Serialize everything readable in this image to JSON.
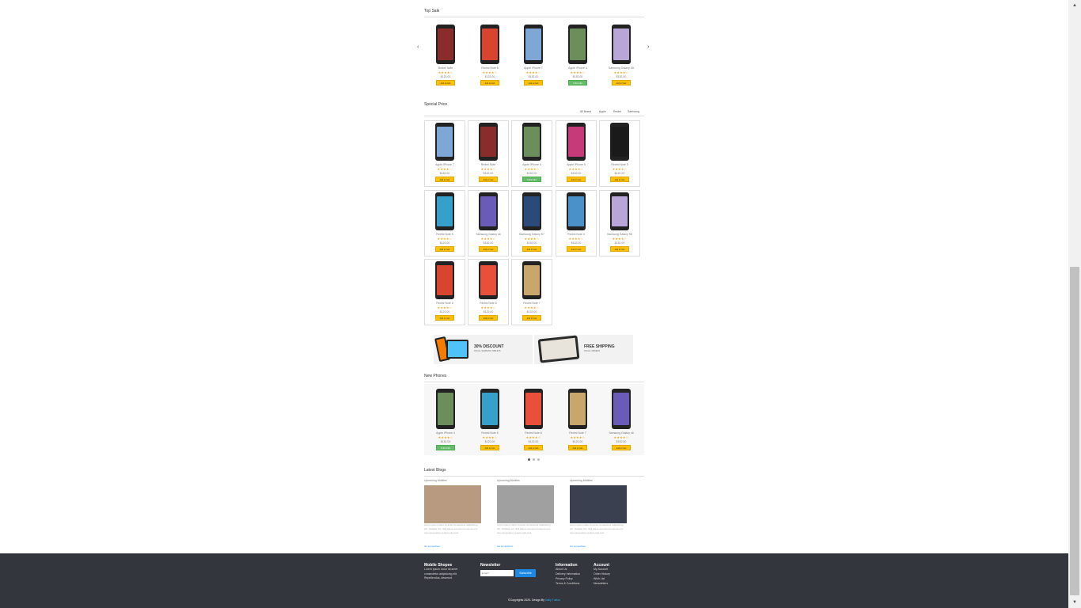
{
  "top_sale": {
    "title": "Top Sale",
    "prev_icon": "‹",
    "next_icon": "›",
    "items": [
      {
        "name": "Redmi Note",
        "stars": "★★★★☆",
        "price": "$120.00",
        "button": "Add to Cart",
        "button_style": "yellow",
        "screen": "#8b2c2c"
      },
      {
        "name": "Redmi Note 6",
        "stars": "★★★★☆",
        "price": "$122.00",
        "button": "Add to Cart",
        "button_style": "yellow",
        "screen": "#d9442f"
      },
      {
        "name": "Apple iPhone 7",
        "stars": "★★★★☆",
        "price": "$152.00",
        "button": "Add to Cart",
        "button_style": "yellow",
        "screen": "#7fa7d6"
      },
      {
        "name": "Apple iPhone 4",
        "stars": "★★★★☆",
        "price": "$152.00",
        "button": "In the Cart",
        "button_style": "green",
        "screen": "#6b8e5a"
      },
      {
        "name": "Samsung Galaxy S6",
        "stars": "★★★★☆",
        "price": "$152.00",
        "button": "Add to Cart",
        "button_style": "yellow",
        "screen": "#b8a6d9"
      }
    ]
  },
  "special_price": {
    "title": "Special Price",
    "filters": [
      "All Brand",
      "Apple",
      "Redmi",
      "Samsung"
    ],
    "items": [
      {
        "name": "Apple iPhone 7",
        "stars": "★★★★☆",
        "price": "$152.00",
        "button": "Add to Cart",
        "button_style": "yellow",
        "screen": "#7fa7d6"
      },
      {
        "name": "Redmi Note",
        "stars": "★★★★☆",
        "price": "$122.00",
        "button": "Add to Cart",
        "button_style": "yellow",
        "screen": "#8b2c2c"
      },
      {
        "name": "Apple iPhone 4",
        "stars": "★★★★☆",
        "price": "$152.00",
        "button": "In the Cart",
        "button_style": "green",
        "screen": "#6b8e5a"
      },
      {
        "name": "Apple iPhone 5",
        "stars": "★★★★☆",
        "price": "$152.00",
        "button": "Add to Cart",
        "button_style": "yellow",
        "screen": "#c63a7a"
      },
      {
        "name": "Redmi Note 5",
        "stars": "★★★★☆",
        "price": "$122.00",
        "button": "Add to Cart",
        "button_style": "yellow",
        "screen": "#1a1a1a"
      },
      {
        "name": "Redmi Note 5",
        "stars": "★★★★☆",
        "price": "$122.00",
        "button": "Add to Cart",
        "button_style": "yellow",
        "screen": "#35a0c9"
      },
      {
        "name": "Samsung Galaxy s6",
        "stars": "★★★★☆",
        "price": "$152.00",
        "button": "Add to Cart",
        "button_style": "yellow",
        "screen": "#6a5bb8"
      },
      {
        "name": "Samsung Galaxy S7",
        "stars": "★★★★☆",
        "price": "$152.00",
        "button": "Add to Cart",
        "button_style": "yellow",
        "screen": "#2a4a7a"
      },
      {
        "name": "Redmi Note 4",
        "stars": "★★★★☆",
        "price": "$122.00",
        "button": "Add to Cart",
        "button_style": "yellow",
        "screen": "#4a90c9"
      },
      {
        "name": "Samsung Galaxy S6",
        "stars": "★★★★☆",
        "price": "$152.00",
        "button": "Add to Cart",
        "button_style": "yellow",
        "screen": "#b8a6d9"
      },
      {
        "name": "Redmi Note 6",
        "stars": "★★★★☆",
        "price": "$122.00",
        "button": "Add to Cart",
        "button_style": "yellow",
        "screen": "#d9442f"
      },
      {
        "name": "Redmi Note 8",
        "stars": "★★★★☆",
        "price": "$122.00",
        "button": "Add to Cart",
        "button_style": "yellow",
        "screen": "#e8503a"
      },
      {
        "name": "Redmi Note 7",
        "stars": "★★★★☆",
        "price": "$122.00",
        "button": "Add to Cart",
        "button_style": "yellow",
        "screen": "#c9a66b"
      }
    ]
  },
  "banners": [
    {
      "title": "30% DISCOUNT",
      "subtitle": "ON ALL SAMSUNG TABLETS"
    },
    {
      "title": "FREE SHIPPING",
      "subtitle": "ON ALL ORDERS"
    }
  ],
  "new_phones": {
    "title": "New Phones",
    "items": [
      {
        "name": "Apple iPhone 4",
        "stars": "★★★★☆",
        "price": "$152.00",
        "button": "In the Cart",
        "button_style": "green",
        "screen": "#6b8e5a"
      },
      {
        "name": "Redmi Note 5",
        "stars": "★★★★☆",
        "price": "$122.00",
        "button": "Add to Cart",
        "button_style": "yellow",
        "screen": "#35a0c9"
      },
      {
        "name": "Redmi Note 8",
        "stars": "★★★★☆",
        "price": "$122.00",
        "button": "Add to Cart",
        "button_style": "yellow",
        "screen": "#e8503a"
      },
      {
        "name": "Redmi Note 7",
        "stars": "★★★★☆",
        "price": "$122.00",
        "button": "Add to Cart",
        "button_style": "yellow",
        "screen": "#c9a66b"
      },
      {
        "name": "Samsung Galaxy s6",
        "stars": "★★★★☆",
        "price": "$152.00",
        "button": "Add to Cart",
        "button_style": "yellow",
        "screen": "#6a5bb8"
      }
    ]
  },
  "blogs": {
    "title": "Latest Blogs",
    "items": [
      {
        "category": "Upcoming Mobiles",
        "text": "Lorem ipsum dolor sit amet consectetur adipisicing elit. Veritatis non nihil atque excepturi tempora rem nisi consectetur veniam iure sed.",
        "link": "Go somewhere",
        "img": "#b89a80"
      },
      {
        "category": "Upcoming Mobiles",
        "text": "Lorem ipsum dolor sit amet consectetur adipisicing elit. Veritatis non nihil atque excepturi tempora rem nisi consectetur veniam iure sed.",
        "link": "Go somewhere",
        "img": "#a0a0a0"
      },
      {
        "category": "Upcoming Mobiles",
        "text": "Lorem ipsum dolor sit amet consectetur adipisicing elit. Veritatis non nihil atque excepturi tempora rem nisi consectetur veniam iure sed.",
        "link": "Go somewhere",
        "img": "#3a4050"
      }
    ]
  },
  "footer": {
    "brand_title": "Mobile Shopee",
    "brand_text": "Lorem ipsum dolor sit amet consectetur adipisicing elit. Repellendus, deserunt.",
    "newsletter_title": "Newsletter",
    "email_placeholder": "Email *",
    "subscribe_label": "Subscribe",
    "info_title": "Information",
    "info_links": [
      "About Us",
      "Delivery Information",
      "Privacy Policy",
      "Terms & Conditions"
    ],
    "account_title": "Account",
    "account_links": [
      "My Account",
      "Order History",
      "Wish List",
      "Newsletters"
    ],
    "copyright_text": "©Copyrights 2020. Design By",
    "copyright_link": "Daily Tuition"
  },
  "colors": {
    "accent_yellow": "#ffc107",
    "in_cart_green": "#66bb6a",
    "footer_bg": "#33363c",
    "subscribe_blue": "#1e88e5"
  }
}
